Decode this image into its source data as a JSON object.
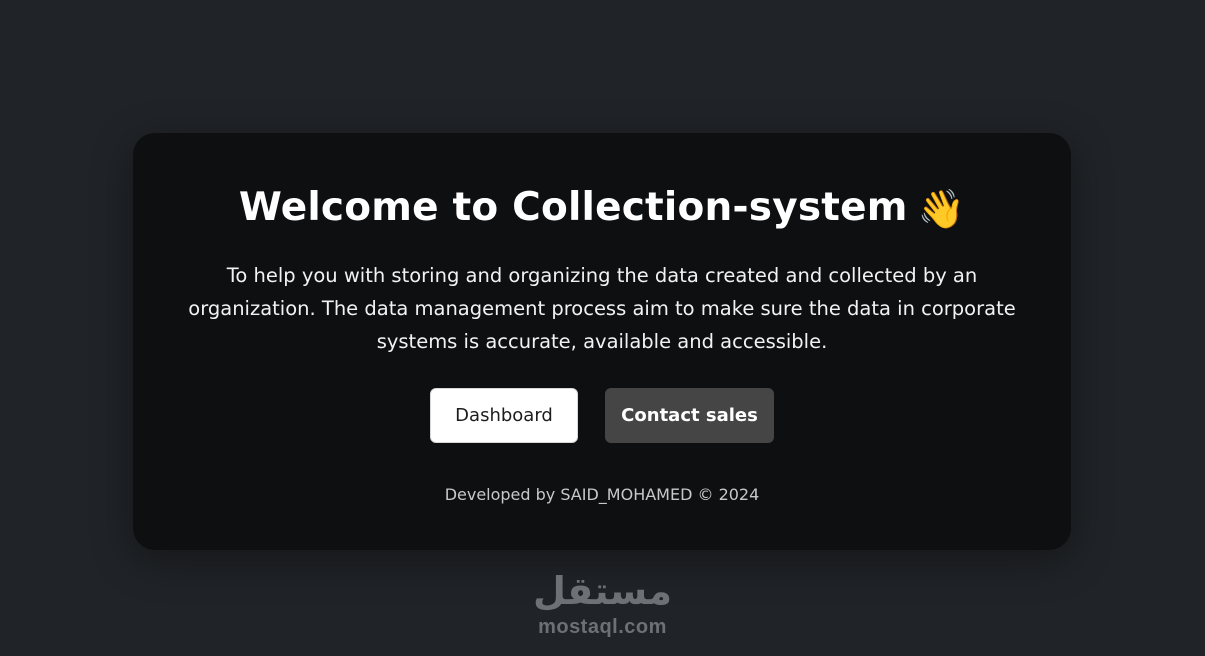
{
  "card": {
    "title": "Welcome to Collection-system",
    "title_icon": "👋",
    "description": "To help you with storing and organizing the data created and collected by an organization. The data management process aim to make sure the data in corporate systems is accurate, available and accessible.",
    "buttons": {
      "dashboard_label": "Dashboard",
      "contact_label": "Contact sales"
    },
    "footer": "Developed by SAID_MOHAMED © 2024"
  },
  "watermark": {
    "arabic": "مستقل",
    "latin": "mostaql.com"
  },
  "icons": {
    "title_icon": "waving-hand-icon"
  },
  "colors": {
    "page_background": "#202327",
    "card_background": "#0e0f11",
    "primary_button": "#ffffff",
    "secondary_button": "#454546"
  }
}
